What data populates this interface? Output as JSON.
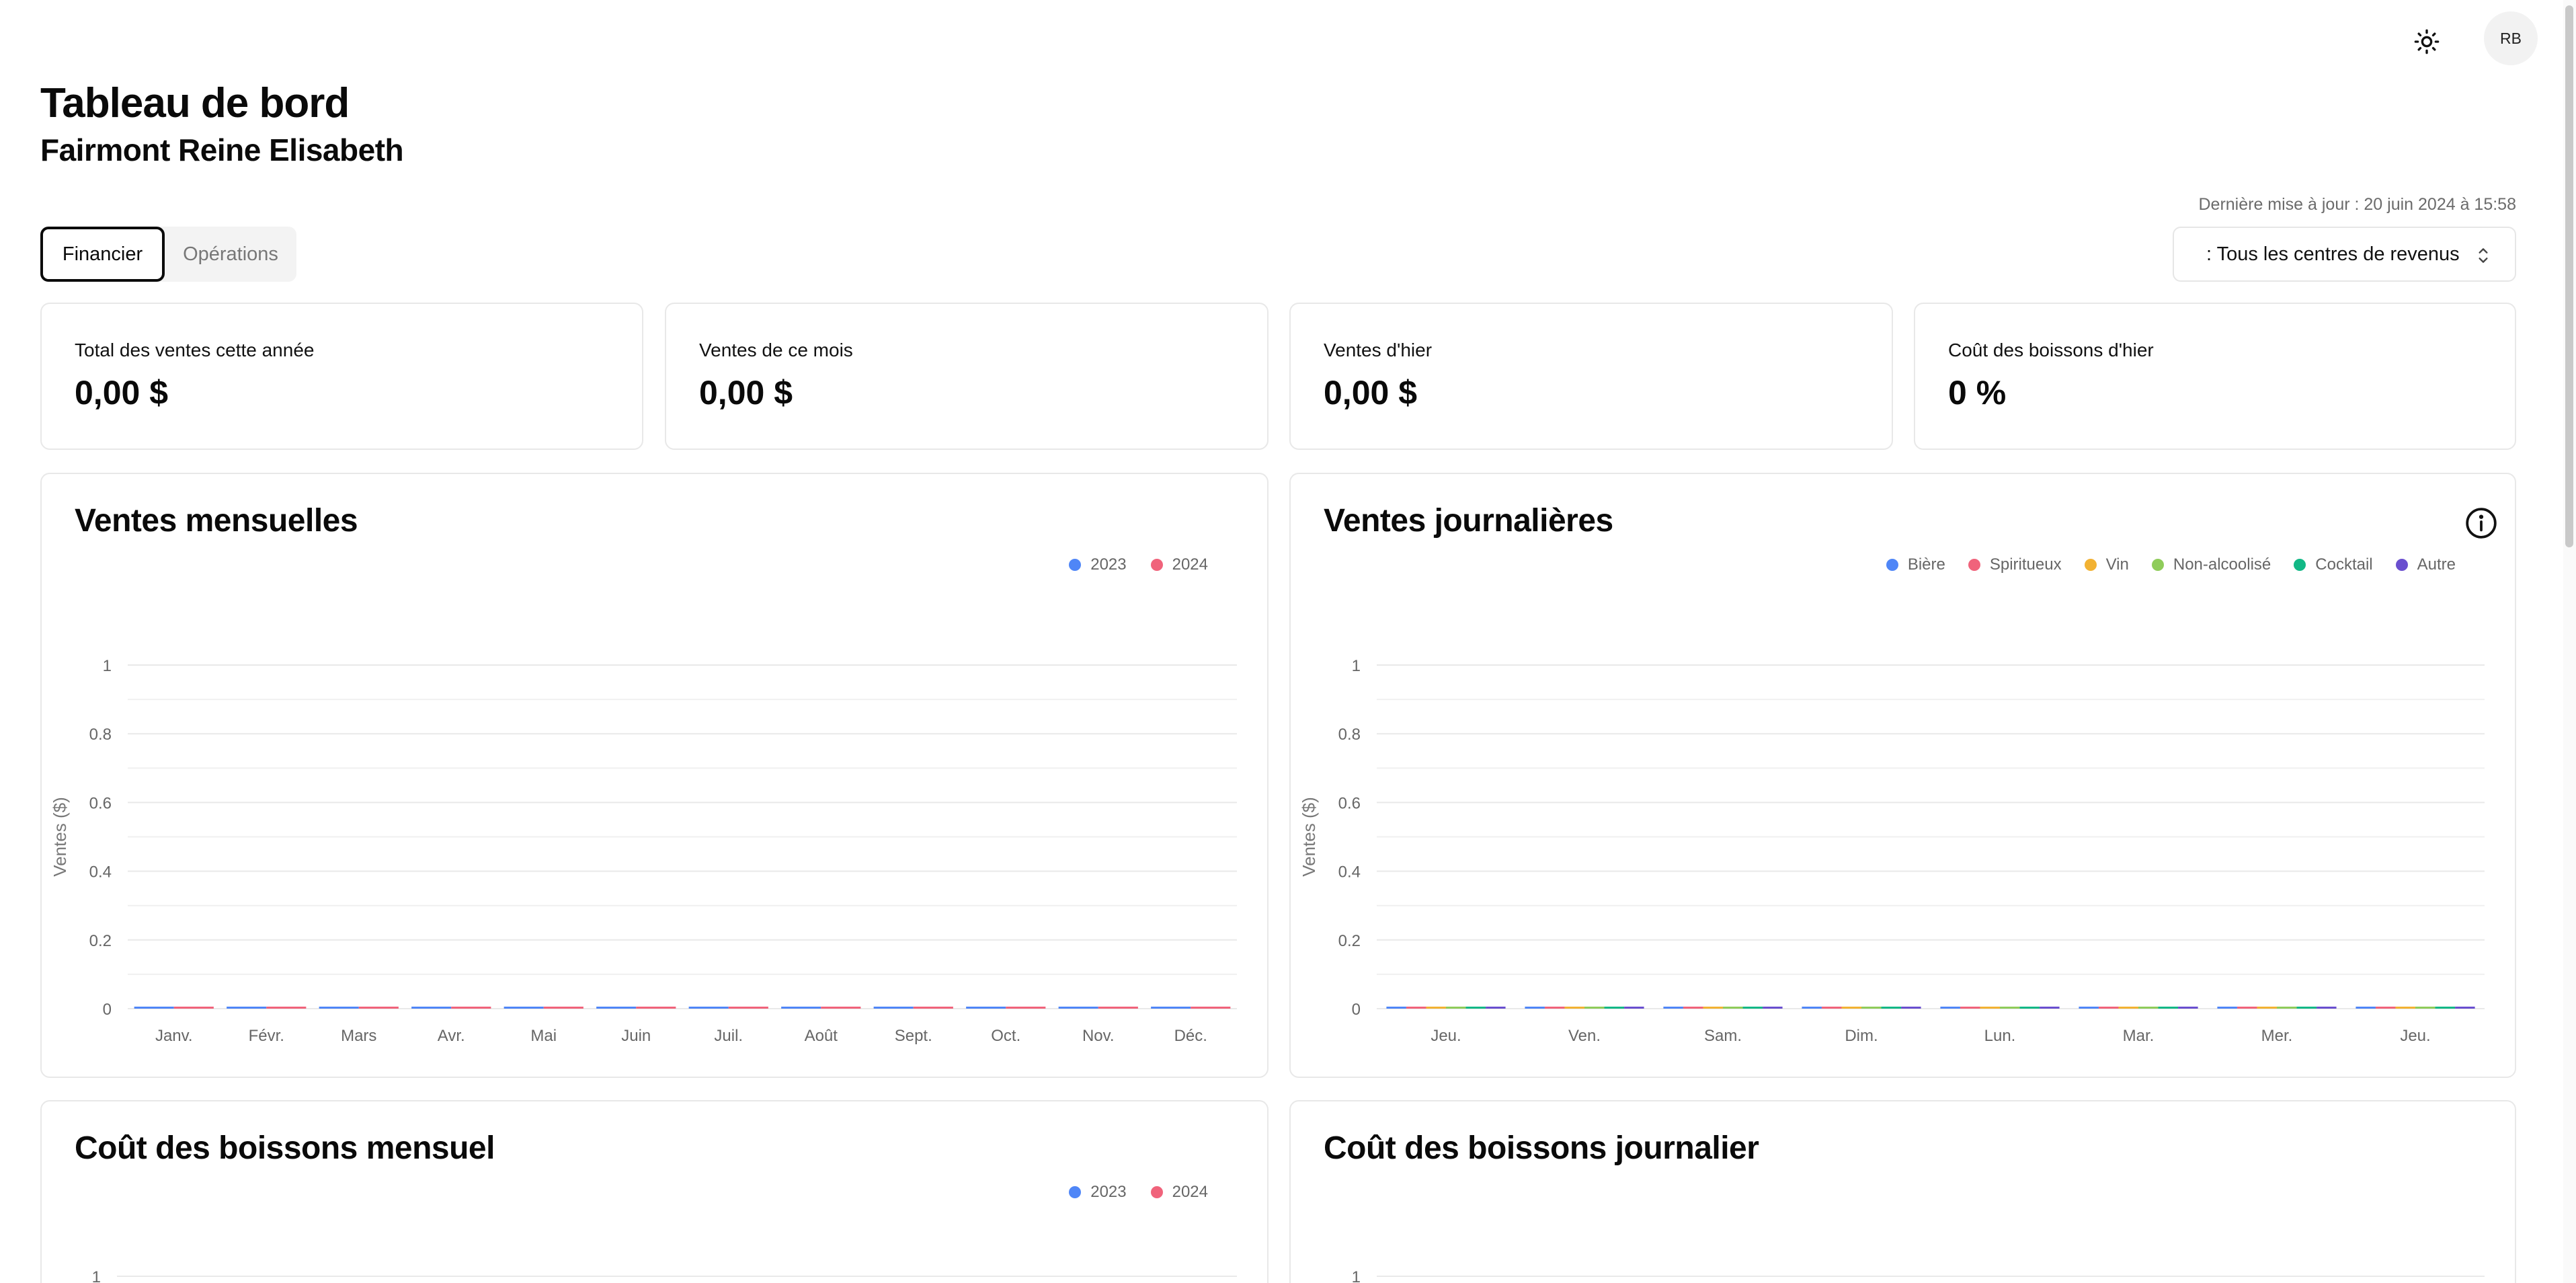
{
  "header": {
    "theme_icon": "sun-icon",
    "avatar_initials": "RB",
    "title": "Tableau de bord",
    "subtitle": "Fairmont Reine Elisabeth",
    "last_update": "Dernière mise à jour : 20 juin 2024 à 15:58"
  },
  "tabs": [
    {
      "label": "Financier",
      "active": true
    },
    {
      "label": "Opérations",
      "active": false
    }
  ],
  "revenue_select": {
    "value": ": Tous les centres de revenus",
    "icon": "chevron-up-down-icon"
  },
  "kpis": [
    {
      "label": "Total des ventes cette année",
      "value": "0,00 $"
    },
    {
      "label": "Ventes de ce mois",
      "value": "0,00 $"
    },
    {
      "label": "Ventes d'hier",
      "value": "0,00 $"
    },
    {
      "label": "Coût des boissons d'hier",
      "value": "0 %"
    }
  ],
  "colors": {
    "c2023": "#4f86f7",
    "c2024": "#f0637b",
    "biere": "#4f86f7",
    "spiritueux": "#f0637b",
    "vin": "#f2b233",
    "non_alcoolise": "#8fcc5a",
    "cocktail": "#12b886",
    "autre": "#6a4fcf"
  },
  "charts": {
    "monthly_sales": {
      "title": "Ventes mensuelles",
      "legend": [
        "2023",
        "2024"
      ]
    },
    "daily_sales": {
      "title": "Ventes journalières",
      "legend": [
        "Bière",
        "Spiritueux",
        "Vin",
        "Non-alcoolisé",
        "Cocktail",
        "Autre"
      ],
      "info_icon": "info-icon"
    },
    "monthly_cost": {
      "title": "Coût des boissons mensuel",
      "legend": [
        "2023",
        "2024"
      ]
    },
    "daily_cost": {
      "title": "Coût des boissons journalier"
    }
  },
  "chart_data": [
    {
      "type": "bar",
      "title": "Ventes mensuelles",
      "ylabel": "Ventes ($)",
      "xlabel": "",
      "categories": [
        "Janv.",
        "Févr.",
        "Mars",
        "Avr.",
        "Mai",
        "Juin",
        "Juil.",
        "Août",
        "Sept.",
        "Oct.",
        "Nov.",
        "Déc."
      ],
      "series": [
        {
          "name": "2023",
          "values": [
            0,
            0,
            0,
            0,
            0,
            0,
            0,
            0,
            0,
            0,
            0,
            0
          ]
        },
        {
          "name": "2024",
          "values": [
            0,
            0,
            0,
            0,
            0,
            0,
            0,
            0,
            0,
            0,
            0,
            0
          ]
        }
      ],
      "yticks": [
        "0",
        "0.2",
        "0.4",
        "0.6",
        "0.8",
        "1"
      ],
      "ylim": [
        0,
        1
      ],
      "grid": true,
      "legend_position": "top-right"
    },
    {
      "type": "bar",
      "title": "Ventes journalières",
      "ylabel": "Ventes ($)",
      "xlabel": "",
      "categories": [
        "Jeu.",
        "Ven.",
        "Sam.",
        "Dim.",
        "Lun.",
        "Mar.",
        "Mer.",
        "Jeu."
      ],
      "series": [
        {
          "name": "Bière",
          "values": [
            0,
            0,
            0,
            0,
            0,
            0,
            0,
            0
          ]
        },
        {
          "name": "Spiritueux",
          "values": [
            0,
            0,
            0,
            0,
            0,
            0,
            0,
            0
          ]
        },
        {
          "name": "Vin",
          "values": [
            0,
            0,
            0,
            0,
            0,
            0,
            0,
            0
          ]
        },
        {
          "name": "Non-alcoolisé",
          "values": [
            0,
            0,
            0,
            0,
            0,
            0,
            0,
            0
          ]
        },
        {
          "name": "Cocktail",
          "values": [
            0,
            0,
            0,
            0,
            0,
            0,
            0,
            0
          ]
        },
        {
          "name": "Autre",
          "values": [
            0,
            0,
            0,
            0,
            0,
            0,
            0,
            0
          ]
        }
      ],
      "yticks": [
        "0",
        "0.2",
        "0.4",
        "0.6",
        "0.8",
        "1"
      ],
      "ylim": [
        0,
        1
      ],
      "grid": true,
      "legend_position": "top-right"
    },
    {
      "type": "bar",
      "title": "Coût des boissons mensuel",
      "legend": [
        "2023",
        "2024"
      ],
      "yticks": [
        "1"
      ],
      "ylim": [
        0,
        1
      ],
      "legend_position": "top-right"
    },
    {
      "type": "bar",
      "title": "Coût des boissons journalier",
      "yticks": [
        "1"
      ],
      "ylim": [
        0,
        1
      ]
    }
  ]
}
